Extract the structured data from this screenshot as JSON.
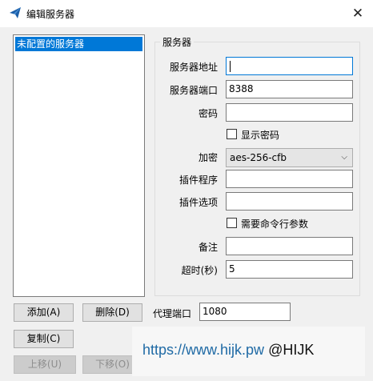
{
  "window": {
    "title": "编辑服务器",
    "close_glyph": "✕"
  },
  "server_list": {
    "items": [
      "未配置的服务器"
    ]
  },
  "server_group": {
    "title": "服务器",
    "address_label": "服务器地址",
    "address_value": "",
    "port_label": "服务器端口",
    "port_value": "8388",
    "password_label": "密码",
    "password_value": "",
    "show_password_label": "显示密码",
    "encryption_label": "加密",
    "encryption_value": "aes-256-cfb",
    "plugin_label": "插件程序",
    "plugin_value": "",
    "plugin_options_label": "插件选项",
    "plugin_options_value": "",
    "plugin_args_label": "需要命令行参数",
    "remarks_label": "备注",
    "remarks_value": "",
    "timeout_label": "超时(秒)",
    "timeout_value": "5"
  },
  "buttons": {
    "add": "添加(A)",
    "delete": "删除(D)",
    "copy": "复制(C)",
    "move_up": "上移(U)",
    "move_down": "下移(O)"
  },
  "proxy": {
    "port_label": "代理端口",
    "port_value": "1080"
  },
  "watermark": {
    "url": "https://www.hijk.pw",
    "handle": "@HIJK"
  },
  "colors": {
    "accent": "#0078d7",
    "window_bg": "#f0f0f0",
    "watermark_url": "#1f6aa5"
  },
  "icons": {
    "title_icon": "paper-plane-icon",
    "select_arrow": "chevron-down-icon"
  }
}
